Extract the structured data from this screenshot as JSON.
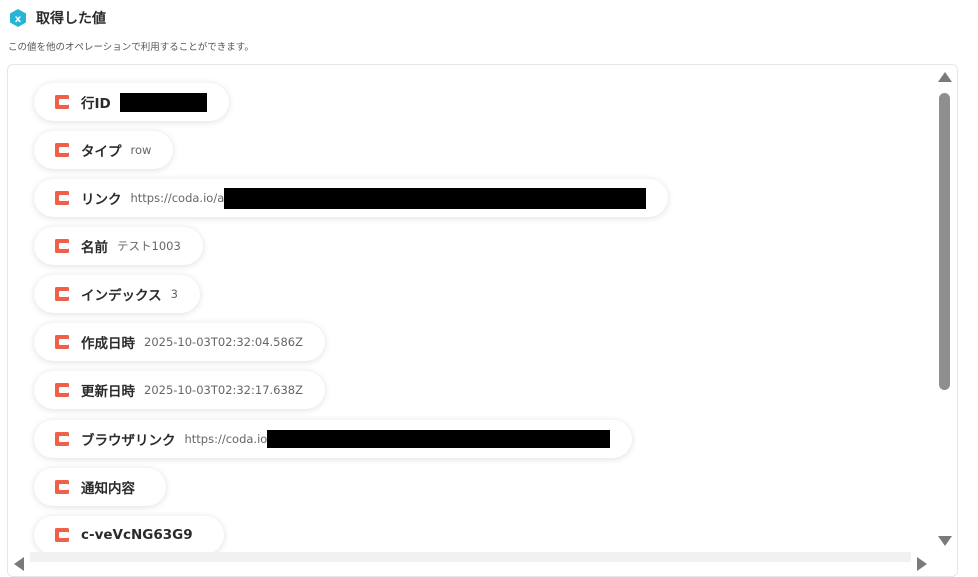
{
  "header": {
    "title": "取得した値",
    "subtitle": "この値を他のオペレーションで利用することができます。"
  },
  "colors": {
    "accent_icon": "#27b4d7",
    "coda_icon": "#f05f48"
  },
  "items": [
    {
      "icon": "coda-icon",
      "label": "行ID",
      "value": "",
      "redacted": true
    },
    {
      "icon": "coda-icon",
      "label": "タイプ",
      "value": "row"
    },
    {
      "icon": "coda-icon",
      "label": "リンク",
      "value": "https://coda.io/a",
      "redacted": true
    },
    {
      "icon": "coda-icon",
      "label": "名前",
      "value": "テスト1003"
    },
    {
      "icon": "coda-icon",
      "label": "インデックス",
      "value": "3"
    },
    {
      "icon": "coda-icon",
      "label": "作成日時",
      "value": "2025-10-03T02:32:04.586Z"
    },
    {
      "icon": "coda-icon",
      "label": "更新日時",
      "value": "2025-10-03T02:32:17.638Z"
    },
    {
      "icon": "coda-icon",
      "label": "ブラウザリンク",
      "value": "https://coda.io",
      "redacted": true
    },
    {
      "icon": "coda-icon",
      "label": "通知内容",
      "value": ""
    },
    {
      "icon": "coda-icon",
      "label": "c-veVcNG63G9",
      "value": ""
    }
  ]
}
